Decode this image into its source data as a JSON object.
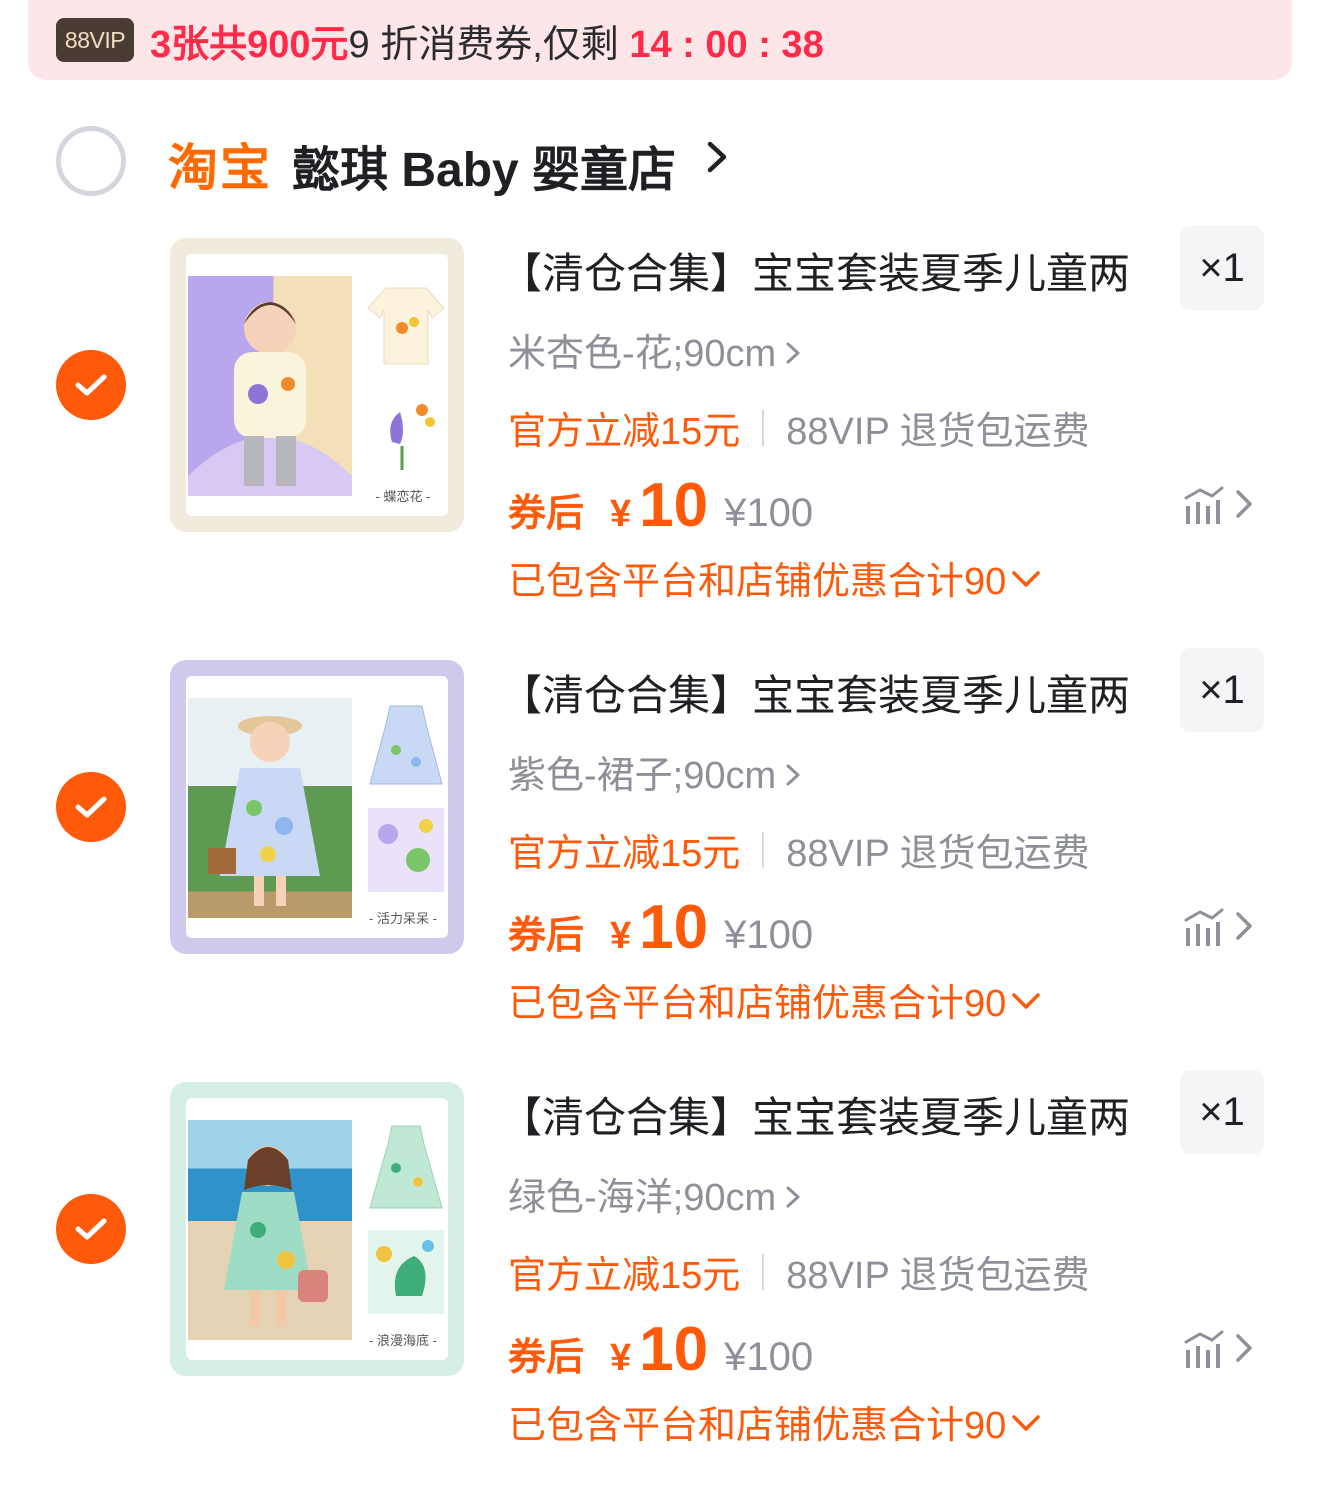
{
  "banner": {
    "badge": "88VIP",
    "text_part1": "3张共",
    "text_amount": "900元",
    "text_part2": "9 折消费券,仅剩",
    "countdown": "14 : 00 : 38"
  },
  "store": {
    "platform": "淘宝",
    "name": "懿琪 Baby 婴童店",
    "selected": false
  },
  "items": [
    {
      "title": "【清仓合集】宝宝套装夏季儿童两",
      "quantity": "×1",
      "sku": "米杏色-花;90cm",
      "promo_discount": "官方立减15元",
      "promo_shipping": "88VIP 退货包运费",
      "price_label": "券后",
      "currency": "¥",
      "price": "10",
      "original_price": "¥100",
      "discount_note": "已包含平台和店铺优惠合计90",
      "thumb_caption": "- 蝶恋花 -",
      "selected": true,
      "theme_color": "#f1ebdd",
      "photo_bg": "#b9a7ee"
    },
    {
      "title": "【清仓合集】宝宝套装夏季儿童两",
      "quantity": "×1",
      "sku": "紫色-裙子;90cm",
      "promo_discount": "官方立减15元",
      "promo_shipping": "88VIP 退货包运费",
      "price_label": "券后",
      "currency": "¥",
      "price": "10",
      "original_price": "¥100",
      "discount_note": "已包含平台和店铺优惠合计90",
      "thumb_caption": "- 活力呆呆 -",
      "selected": true,
      "theme_color": "#cfc9ec",
      "photo_bg": "#7fb06a"
    },
    {
      "title": "【清仓合集】宝宝套装夏季儿童两",
      "quantity": "×1",
      "sku": "绿色-海洋;90cm",
      "promo_discount": "官方立减15元",
      "promo_shipping": "88VIP 退货包运费",
      "price_label": "券后",
      "currency": "¥",
      "price": "10",
      "original_price": "¥100",
      "discount_note": "已包含平台和店铺优惠合计90",
      "thumb_caption": "- 浪漫海底 -",
      "selected": true,
      "theme_color": "#d6efe6",
      "photo_bg": "#7fc3d8"
    }
  ],
  "colors": {
    "accent": "#ff5a0a",
    "banner_red": "#ff2a4a",
    "banner_bg": "#fde6e8",
    "muted": "#8e9099"
  },
  "icons": {
    "check": "check-icon",
    "chevron": "chevron-right-icon",
    "trend": "price-trend-icon",
    "dropdown": "chevron-down-icon"
  }
}
